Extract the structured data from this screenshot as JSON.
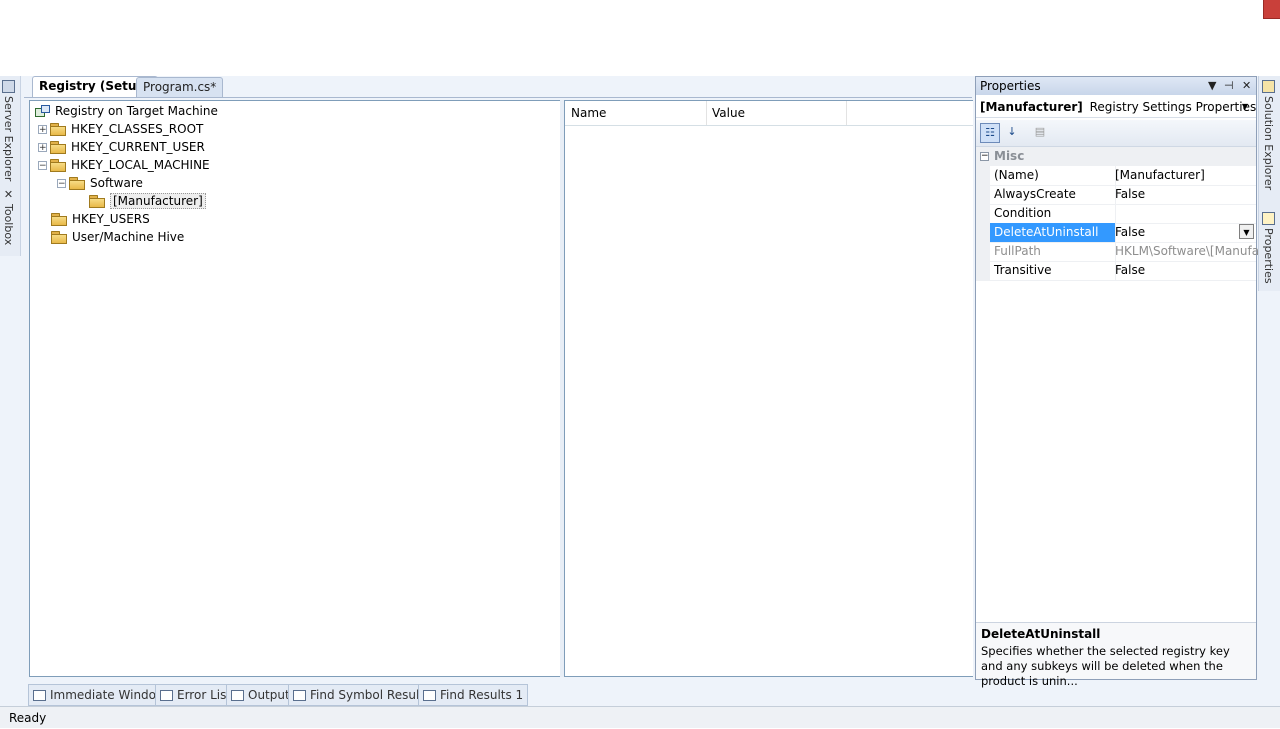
{
  "left_strip": {
    "server_explorer": "Server Explorer",
    "toolbox": "Toolbox"
  },
  "document_tabs": [
    {
      "label": "Registry (Setup)",
      "active": true
    },
    {
      "label": "Program.cs*",
      "active": false
    }
  ],
  "registry_tree": {
    "root": "Registry on Target Machine",
    "nodes": [
      {
        "label": "HKEY_CLASSES_ROOT"
      },
      {
        "label": "HKEY_CURRENT_USER"
      },
      {
        "label": "HKEY_LOCAL_MACHINE"
      },
      {
        "label": "Software"
      },
      {
        "label": "[Manufacturer]"
      },
      {
        "label": "HKEY_USERS"
      },
      {
        "label": "User/Machine Hive"
      }
    ],
    "expander_collapsed": "+",
    "expander_expanded": "−"
  },
  "value_list": {
    "columns": [
      "Name",
      "Value"
    ]
  },
  "properties": {
    "title": "Properties",
    "object_name": "[Manufacturer]",
    "object_type": "Registry Settings Properties",
    "category": "Misc",
    "rows": [
      {
        "name": "(Name)",
        "value": "[Manufacturer]"
      },
      {
        "name": "AlwaysCreate",
        "value": "False"
      },
      {
        "name": "Condition",
        "value": ""
      },
      {
        "name": "DeleteAtUninstall",
        "value": "False"
      },
      {
        "name": "FullPath",
        "value": "HKLM\\Software\\[Manufacturer]"
      },
      {
        "name": "Transitive",
        "value": "False"
      }
    ],
    "selected_row": "DeleteAtUninstall",
    "description_title": "DeleteAtUninstall",
    "description_text": "Specifies whether the selected registry key and any subkeys will be deleted when the product is unin..."
  },
  "right_strip": {
    "solution_explorer": "Solution Explorer",
    "properties": "Properties"
  },
  "bottom_tabs": [
    "Immediate Window",
    "Error List",
    "Output",
    "Find Symbol Results",
    "Find Results 1"
  ],
  "status": "Ready",
  "colors": {
    "selection": "#3399ff",
    "folder": "#e8b949",
    "panel_border": "#7f9db9"
  }
}
